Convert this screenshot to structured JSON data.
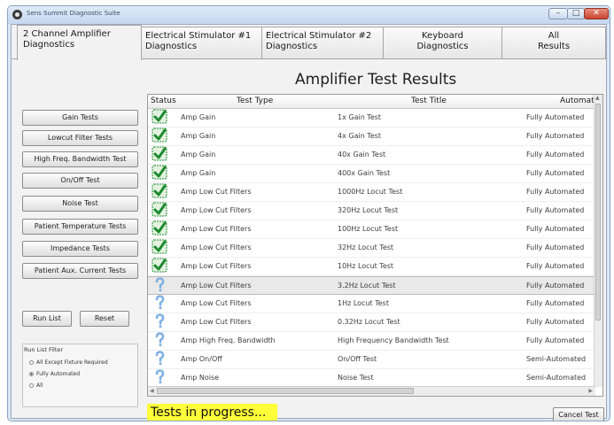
{
  "window": {
    "title": "Sens Summit Diagnostic Suite",
    "controls": [
      "–",
      "□",
      "✕"
    ]
  },
  "tabs": [
    {
      "line1": "2 Channel Amplifier",
      "line2": "Diagnostics",
      "active": true
    },
    {
      "line1": "Electrical Stimulator #1",
      "line2": "Diagnostics",
      "active": false
    },
    {
      "line1": "Electrical Stimulator #2",
      "line2": "Diagnostics",
      "active": false
    },
    {
      "line1": "Keyboard",
      "line2": "Diagnostics",
      "active": false
    },
    {
      "line1": "All",
      "line2": "Results",
      "active": false
    }
  ],
  "heading": "Amplifier Test Results",
  "side_buttons": [
    "Gain Tests",
    "Lowcut Filter Tests",
    "High Freq. Bandwidth Test",
    "On/Off Test",
    "Noise Test",
    "Patient Temperature Tests",
    "Impedance Tests",
    "Patient Aux. Current Tests"
  ],
  "run_list_label": "Run List",
  "reset_label": "Reset",
  "filter": {
    "title": "Run List Filter",
    "options": [
      {
        "label": "All Except Fixture Required",
        "selected": false
      },
      {
        "label": "Fully Automated",
        "selected": true
      },
      {
        "label": "All",
        "selected": false
      }
    ]
  },
  "table": {
    "columns": [
      "Status",
      "Test Type",
      "Test Title",
      "Automat"
    ],
    "rows": [
      {
        "status": "pass",
        "type": "Amp Gain",
        "title": "1x Gain Test",
        "auto": "Fully Automated"
      },
      {
        "status": "pass",
        "type": "Amp Gain",
        "title": "4x Gain Test",
        "auto": "Fully Automated"
      },
      {
        "status": "pass",
        "type": "Amp Gain",
        "title": "40x Gain Test",
        "auto": "Fully Automated"
      },
      {
        "status": "pass",
        "type": "Amp Gain",
        "title": "400x Gain Test",
        "auto": "Fully Automated"
      },
      {
        "status": "pass",
        "type": "Amp Low Cut Filters",
        "title": "1000Hz Locut Test",
        "auto": "Fully Automated"
      },
      {
        "status": "pass",
        "type": "Amp Low Cut Filters",
        "title": "320Hz Locut Test",
        "auto": "Fully Automated"
      },
      {
        "status": "pass",
        "type": "Amp Low Cut Filters",
        "title": "100Hz Locut Test",
        "auto": "Fully Automated"
      },
      {
        "status": "pass",
        "type": "Amp Low Cut Filters",
        "title": "32Hz Locut Test",
        "auto": "Fully Automated"
      },
      {
        "status": "pass",
        "type": "Amp Low Cut Filters",
        "title": "10Hz Locut Test",
        "auto": "Fully Automated"
      },
      {
        "status": "pending",
        "type": "Amp Low Cut Filters",
        "title": "3.2Hz Locut Test",
        "auto": "Fully Automated",
        "selected": true
      },
      {
        "status": "pending",
        "type": "Amp Low Cut Filters",
        "title": "1Hz Locut Test",
        "auto": "Fully Automated"
      },
      {
        "status": "pending",
        "type": "Amp Low Cut Filters",
        "title": "0.32Hz Locut Test",
        "auto": "Fully Automated"
      },
      {
        "status": "pending",
        "type": "Amp High Freq. Bandwidth",
        "title": "High Frequency Bandwidth Test",
        "auto": "Fully Automated"
      },
      {
        "status": "pending",
        "type": "Amp On/Off",
        "title": "On/Off Test",
        "auto": "Semi-Automated"
      },
      {
        "status": "pending",
        "type": "Amp Noise",
        "title": "Noise Test",
        "auto": "Semi-Automated"
      }
    ]
  },
  "status_text": "Tests in progress...",
  "cancel_label": "Cancel Test",
  "colors": {
    "pass": "#1d8a2e",
    "pending": "#7fb1e3",
    "status_highlight": "#ffff3a",
    "title_bar": "#c5d7ee"
  },
  "icons": {
    "pass": "green-check-icon",
    "pending": "question-mark-icon"
  }
}
